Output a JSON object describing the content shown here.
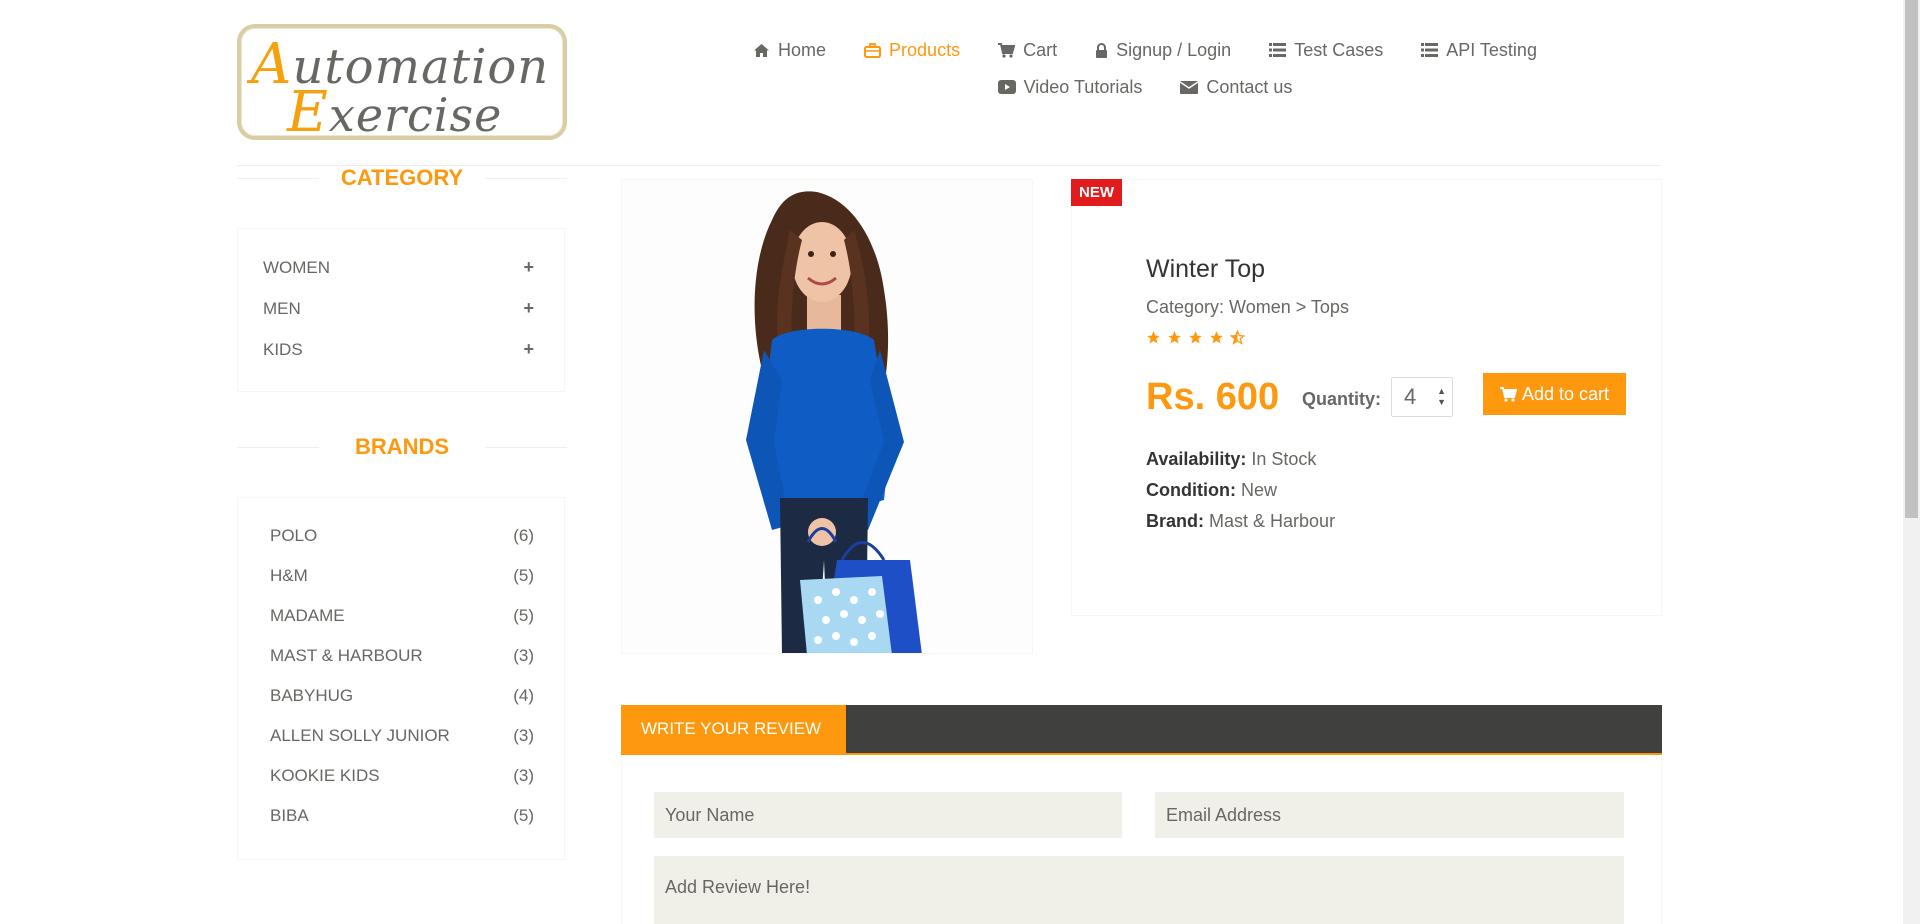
{
  "logo": {
    "line1_cap": "A",
    "line1_rest": "utomation",
    "line2_cap": "E",
    "line2_rest": "xercise"
  },
  "nav": {
    "row1": [
      {
        "label": "Home",
        "icon": "home-icon",
        "active": false
      },
      {
        "label": "Products",
        "icon": "briefcase-icon",
        "active": true
      },
      {
        "label": "Cart",
        "icon": "cart-icon",
        "active": false
      },
      {
        "label": "Signup / Login",
        "icon": "lock-icon",
        "active": false
      },
      {
        "label": "Test Cases",
        "icon": "list-icon",
        "active": false
      },
      {
        "label": "API Testing",
        "icon": "list-icon",
        "active": false
      }
    ],
    "row2": [
      {
        "label": "Video Tutorials",
        "icon": "youtube-play-icon",
        "active": false
      },
      {
        "label": "Contact us",
        "icon": "envelope-icon",
        "active": false
      }
    ]
  },
  "sidebar": {
    "category_title": "CATEGORY",
    "categories": [
      {
        "label": "WOMEN",
        "toggle": "+"
      },
      {
        "label": "MEN",
        "toggle": "+"
      },
      {
        "label": "KIDS",
        "toggle": "+"
      }
    ],
    "brands_title": "BRANDS",
    "brands": [
      {
        "label": "POLO",
        "count": "(6)"
      },
      {
        "label": "H&M",
        "count": "(5)"
      },
      {
        "label": "MADAME",
        "count": "(5)"
      },
      {
        "label": "MAST & HARBOUR",
        "count": "(3)"
      },
      {
        "label": "BABYHUG",
        "count": "(4)"
      },
      {
        "label": "ALLEN SOLLY JUNIOR",
        "count": "(3)"
      },
      {
        "label": "KOOKIE KIDS",
        "count": "(3)"
      },
      {
        "label": "BIBA",
        "count": "(5)"
      }
    ]
  },
  "product": {
    "badge": "NEW",
    "name": "Winter Top",
    "category": "Category: Women > Tops",
    "rating": 4.5,
    "price": "Rs. 600",
    "quantity_label": "Quantity:",
    "quantity": "4",
    "add_to_cart": "Add to cart",
    "availability_label": "Availability:",
    "availability": "In Stock",
    "condition_label": "Condition:",
    "condition": "New",
    "brand_label": "Brand:",
    "brand": "Mast & Harbour"
  },
  "review": {
    "tab_label": "WRITE YOUR REVIEW",
    "name_placeholder": "Your Name",
    "email_placeholder": "Email Address",
    "review_placeholder": "Add Review Here!"
  },
  "colors": {
    "accent": "#fe980f",
    "badge": "#e21c1c",
    "review_bar": "#40403e",
    "input_bg": "#f0f0e9"
  }
}
